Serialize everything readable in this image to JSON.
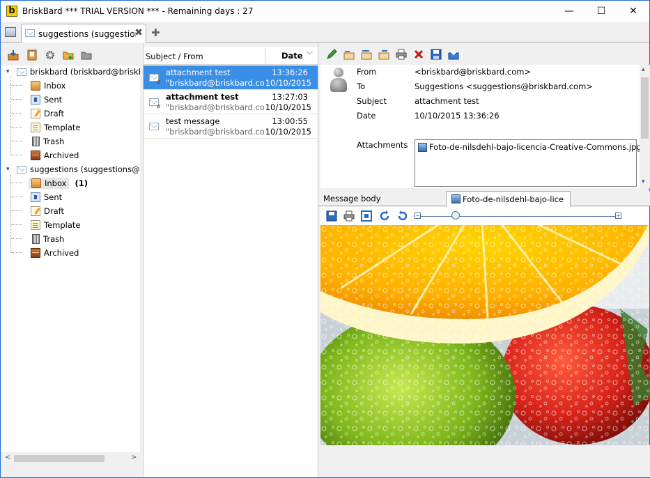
{
  "window": {
    "title": "BriskBard *** TRIAL VERSION *** - Remaining days : 27",
    "logo_letter": "b",
    "minimize_glyph": "—",
    "maximize_glyph": "☐",
    "close_glyph": "✕"
  },
  "tabs": {
    "active_label": "suggestions (suggestions@",
    "close_glyph": "✖",
    "add_glyph": "✚"
  },
  "tree": {
    "accounts": [
      {
        "label": "briskbard (briskbard@briskbard.c",
        "folders": [
          {
            "label": "Inbox",
            "icon": "inbox-icon"
          },
          {
            "label": "Sent",
            "icon": "sent-icon"
          },
          {
            "label": "Draft",
            "icon": "draft-icon"
          },
          {
            "label": "Template",
            "icon": "template-icon"
          },
          {
            "label": "Trash",
            "icon": "trash-icon"
          },
          {
            "label": "Archived",
            "icon": "archived-icon"
          }
        ]
      },
      {
        "label": "suggestions (suggestions@brisk",
        "folders": [
          {
            "label": "Inbox",
            "icon": "inbox-icon",
            "count": "(1)"
          },
          {
            "label": "Sent",
            "icon": "sent-icon"
          },
          {
            "label": "Draft",
            "icon": "draft-icon"
          },
          {
            "label": "Template",
            "icon": "template-icon"
          },
          {
            "label": "Trash",
            "icon": "trash-icon"
          },
          {
            "label": "Archived",
            "icon": "archived-icon"
          }
        ]
      }
    ]
  },
  "list": {
    "col_subject": "Subject / From",
    "col_date": "Date",
    "messages": [
      {
        "subject": "attachment test",
        "from": "\"briskbard@briskbard.com\" <t",
        "time": "13:36:26",
        "date": "10/10/2015"
      },
      {
        "subject": "attachment test",
        "from": "\"briskbard@briskbard.com\" <t",
        "time": "13:27:03",
        "date": "10/10/2015"
      },
      {
        "subject": "test message",
        "from": "\"briskbard@briskbard.com\" <t",
        "time": "13:00:55",
        "date": "10/10/2015"
      }
    ]
  },
  "message": {
    "from_label": "From",
    "from_value": "<briskbard@briskbard.com>",
    "to_label": "To",
    "to_value": "Suggestions <suggestions@briskbard.com>",
    "subject_label": "Subject",
    "subject_value": "attachment test",
    "date_label": "Date",
    "date_value": "10/10/2015 13:36:26",
    "attachments_label": "Attachments",
    "attachment_file": "Foto-de-nilsdehl-bajo-licencia-Creative-Commons.jpg"
  },
  "viewer_tabs": {
    "body_label": "Message body",
    "attachment_label": "Foto-de-nilsdehl-bajo-lice"
  },
  "colors": {
    "selection": "#3a8ee6",
    "window_border": "#1e6fd9"
  }
}
